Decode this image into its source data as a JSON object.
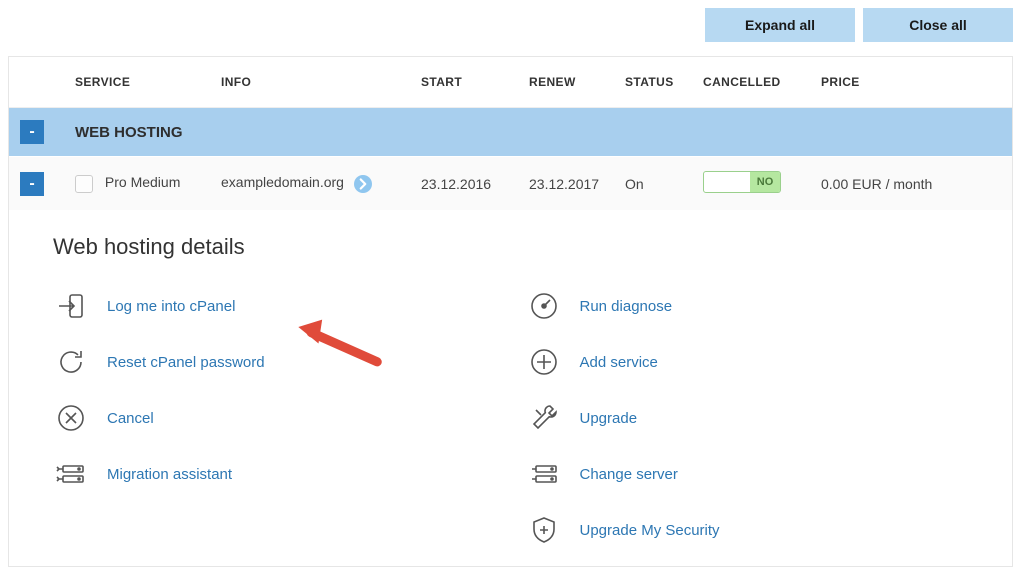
{
  "top": {
    "expand_all": "Expand all",
    "close_all": "Close all"
  },
  "columns": {
    "service": "SERVICE",
    "info": "INFO",
    "start": "START",
    "renew": "RENEW",
    "status": "STATUS",
    "cancelled": "CANCELLED",
    "price": "PRICE"
  },
  "category": {
    "toggle": "-",
    "label": "WEB HOSTING"
  },
  "row": {
    "toggle": "-",
    "service": "Pro Medium",
    "info": "exampledomain.org",
    "start": "23.12.2016",
    "renew": "23.12.2017",
    "status": "On",
    "cancelled_label": "NO",
    "price": "0.00 EUR / month"
  },
  "details": {
    "heading": "Web hosting details",
    "left": {
      "login": "Log me into cPanel",
      "reset": "Reset cPanel password",
      "cancel": "Cancel",
      "migration": "Migration assistant"
    },
    "right": {
      "diagnose": "Run diagnose",
      "add": "Add service",
      "upgrade": "Upgrade",
      "change": "Change server",
      "security": "Upgrade My Security"
    }
  }
}
